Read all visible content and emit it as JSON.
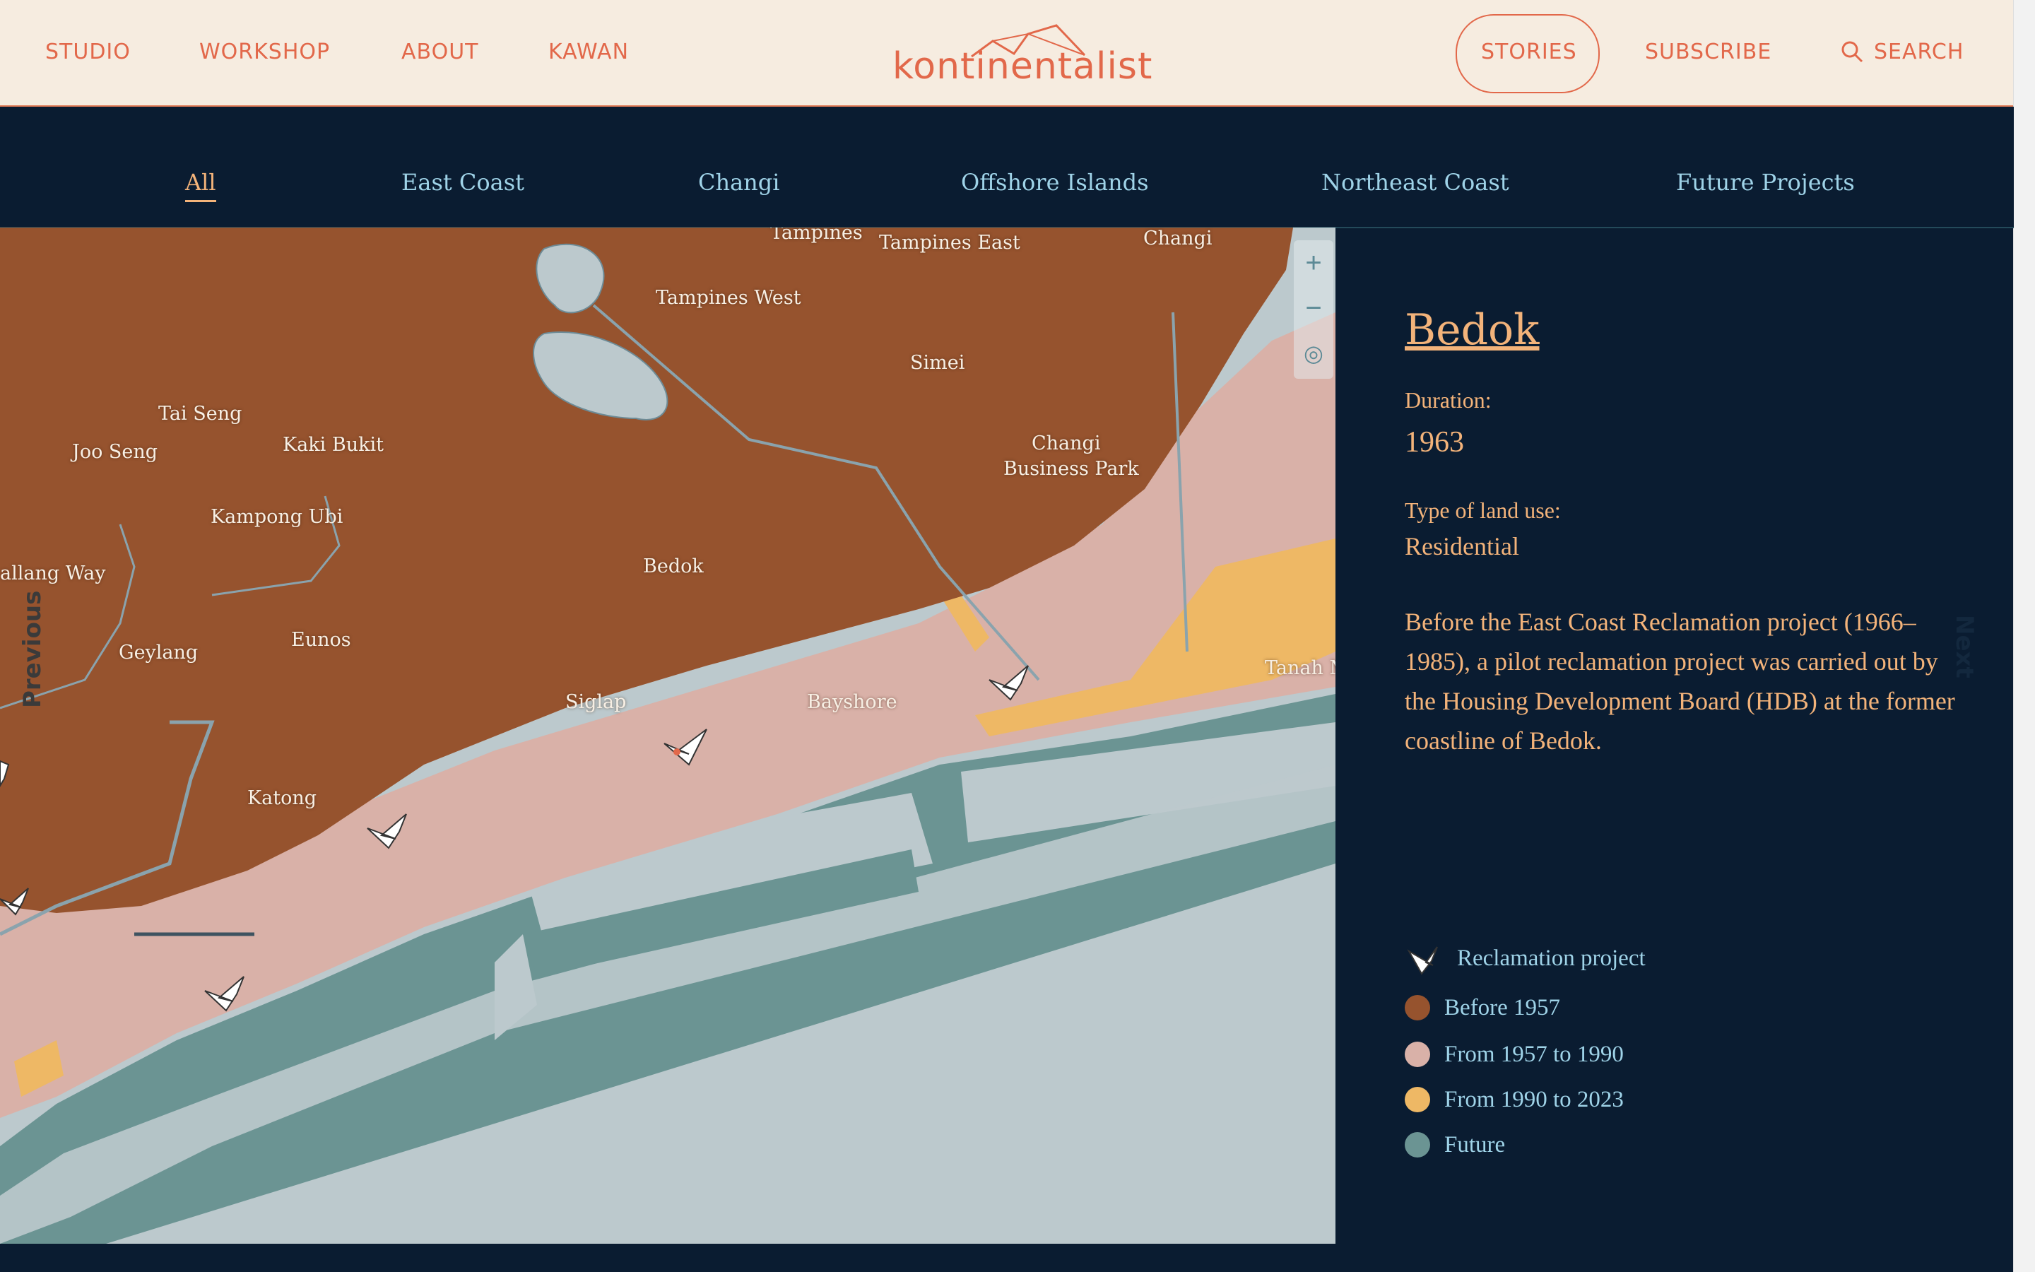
{
  "nav": {
    "left_links": [
      "STUDIO",
      "WORKSHOP",
      "ABOUT",
      "KAWAN"
    ],
    "logo_text": "kontinentalist",
    "right_links": [
      "STORIES",
      "SUBSCRIBE",
      "SEARCH"
    ]
  },
  "tabs": [
    "All",
    "East Coast",
    "Changi",
    "Offshore Islands",
    "Northeast Coast",
    "Future Projects"
  ],
  "active_tab": "All",
  "map": {
    "labels": [
      "Tampines",
      "Tampines East",
      "Changi",
      "Tampines West",
      "Simei",
      "Tai Seng",
      "Joo Seng",
      "Kaki Bukit",
      "Changi",
      "Business Park",
      "Kampong Ubi",
      "allang Way",
      "Bedok",
      "Geylang",
      "Eunos",
      "Tanah M",
      "Siglap",
      "Bayshore",
      "Katong"
    ],
    "zoom_in": "+",
    "zoom_out": "−",
    "locate": "◎",
    "prev_label": "Previous",
    "next_label": "Next"
  },
  "panel": {
    "title": "Bedok",
    "duration_label": "Duration:",
    "duration_value": "1963",
    "landuse_label": "Type of land use:",
    "landuse_value": "Residential",
    "description": "Before the East Coast Reclamation project (1966–1985), a pilot reclamation project was carried out by the Housing Development Board (HDB) at the former coastline of Bedok."
  },
  "legend": [
    {
      "label": "Reclamation project",
      "color": "#ffffff",
      "icon": "reclamation-marker-icon"
    },
    {
      "label": "Before 1957",
      "color": "#96532e"
    },
    {
      "label": "From 1957 to 1990",
      "color": "#d9b1a8"
    },
    {
      "label": "From 1990 to 2023",
      "color": "#eeb865"
    },
    {
      "label": "Future",
      "color": "#6b9493"
    }
  ]
}
